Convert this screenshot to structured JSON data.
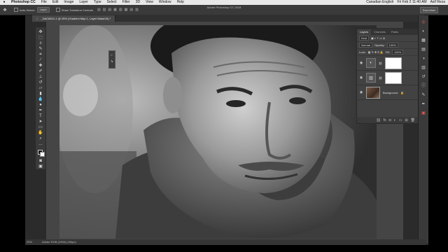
{
  "menubar": {
    "apple": "",
    "app": "Photoshop CC",
    "items": [
      "File",
      "Edit",
      "Image",
      "Layer",
      "Type",
      "Select",
      "Filter",
      "3D",
      "View",
      "Window",
      "Help"
    ],
    "right": [
      "Canadian English",
      "Fri Feb 2  11:40 AM",
      "Asif Reza"
    ]
  },
  "window": {
    "title": "Adobe Photoshop CC 2018"
  },
  "options": {
    "auto_select_label": "Auto-Select:",
    "auto_select_value": "Layer",
    "transform_label": "Show Transform Controls",
    "workspace": "Essentials"
  },
  "document": {
    "tab_label": "_DAC8521-1 @ 25% (Gradient Map 1, Layer Mask/16) *"
  },
  "layers_panel": {
    "tabs": [
      "Layers",
      "Channels",
      "Paths"
    ],
    "kind_label": "Kind",
    "blend_mode": "Normal",
    "opacity_label": "Opacity:",
    "opacity_value": "100%",
    "lock_label": "Lock:",
    "fill_label": "Fill:",
    "fill_value": "100%",
    "layers": [
      {
        "name": "",
        "type": "adjustment"
      },
      {
        "name": "",
        "type": "adjustment"
      },
      {
        "name": "Background",
        "type": "image"
      }
    ]
  },
  "status": {
    "zoom": "25%",
    "info": "Adobe RGB (1998) (16bpc)"
  },
  "colors": {
    "accent_red": "#e05a4f",
    "ui_bg": "#3a3a3a"
  }
}
